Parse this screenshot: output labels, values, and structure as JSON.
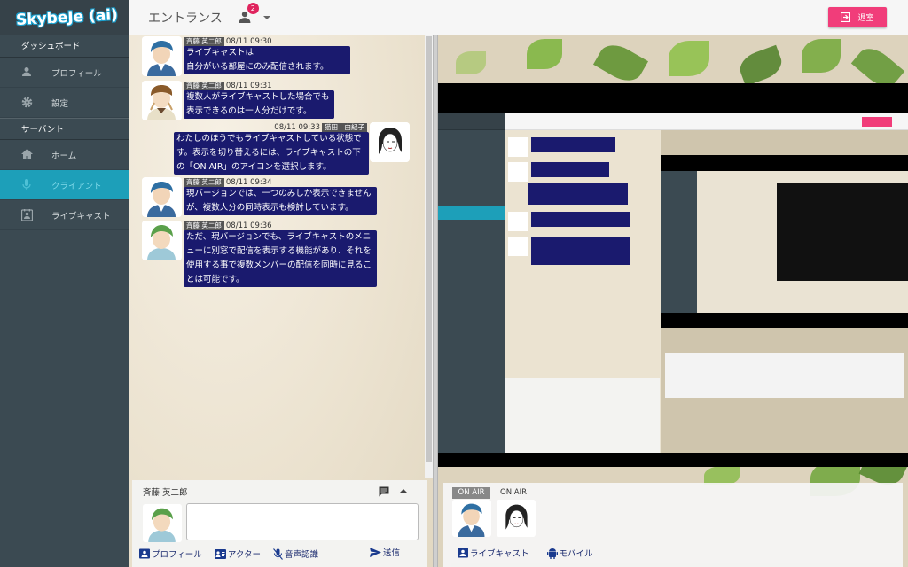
{
  "app": {
    "logo": "SkybeJe (ai)"
  },
  "sidebar": {
    "dashboard": "ダッシュボード",
    "profile": "プロフィール",
    "settings": "設定",
    "servant": "サーバント",
    "home": "ホーム",
    "client": "クライアント",
    "livecast": "ライブキャスト"
  },
  "header": {
    "title": "エントランス",
    "badge": "2",
    "exit_label": "退室"
  },
  "messages": [
    {
      "name": "斉藤 英二郎",
      "time": "08/11 09:30",
      "lines": [
        "ライブキャストは",
        "自分がいる部屋にのみ配信されます。"
      ]
    },
    {
      "name": "斉藤 英二郎",
      "time": "08/11 09:31",
      "lines": [
        "複数人がライブキャストした場合でも",
        "表示できるのは一人分だけです。"
      ]
    },
    {
      "name": "猫田　由紀子",
      "time": "08/11 09:33",
      "lines": [
        "わたしのほうでもライブキャストしている状態で",
        "す。表示を切り替えるには、ライブキャストの下",
        "の「ON AIR」のアイコンを選択します。"
      ]
    },
    {
      "name": "斉藤 英二郎",
      "time": "08/11 09:34",
      "lines": [
        "現バージョンでは、一つのみしか表示できません",
        "が、複数人分の同時表示も検討しています。"
      ]
    },
    {
      "name": "斉藤 英二郎",
      "time": "08/11 09:36",
      "lines": [
        "ただ、現バージョンでも、ライブキャストのメニ",
        "ューに別窓で配信を表示する機能があり、それを",
        "使用する事で複数メンバーの配信を同時に見るこ",
        "とは可能です。"
      ]
    }
  ],
  "composer": {
    "name": "斉藤 英二郎",
    "profile": "プロフィール",
    "actor": "アクター",
    "voice": "音声認識",
    "send": "送信"
  },
  "livestrip": {
    "tag": "ON AIR",
    "label": "ON AIR",
    "livecast": "ライブキャスト",
    "mobile": "モバイル"
  },
  "colors": {
    "sidebar": "#3b4a52",
    "active": "#1d9fb9",
    "bubble": "#1a1a6e",
    "exit": "#f13d7a"
  }
}
